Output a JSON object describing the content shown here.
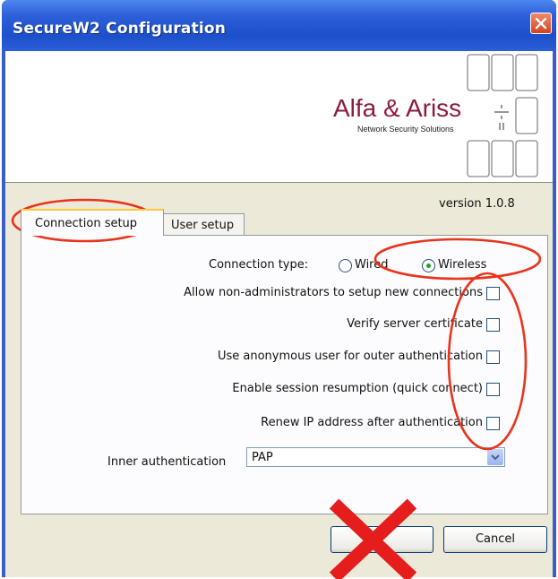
{
  "window": {
    "title": "SecureW2 Configuration"
  },
  "brand": {
    "name": "Alfa & Ariss",
    "tagline": "Network Security Solutions"
  },
  "version": "version 1.0.8",
  "tabs": [
    {
      "label": "Connection setup",
      "active": true
    },
    {
      "label": "User setup",
      "active": false
    }
  ],
  "connection_type": {
    "label": "Connection type:",
    "options": [
      {
        "label": "Wired",
        "selected": false
      },
      {
        "label": "Wireless",
        "selected": true
      }
    ]
  },
  "options": [
    {
      "label": "Allow non-administrators to setup new connections",
      "checked": false
    },
    {
      "label": "Verify server certificate",
      "checked": false
    },
    {
      "label": "Use anonymous user for outer authentication",
      "checked": false
    },
    {
      "label": "Enable session resumption (quick connect)",
      "checked": false
    },
    {
      "label": "Renew IP address after authentication",
      "checked": false
    }
  ],
  "inner_auth": {
    "label": "Inner authentication",
    "value": "PAP"
  },
  "buttons": {
    "ok": "",
    "cancel": "Cancel"
  },
  "colors": {
    "annotation": "#e8341c",
    "titlebar": "#2d5fd9",
    "brand": "#8b1c3a",
    "radio_selected": "#21a121"
  },
  "icons": [
    "close-icon",
    "dropdown-arrow-icon",
    "logo-grid-icon",
    "cross-mark-icon"
  ]
}
